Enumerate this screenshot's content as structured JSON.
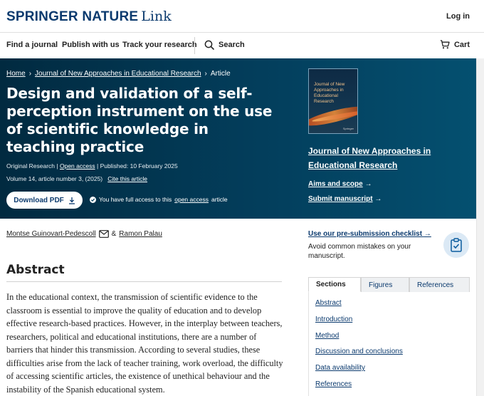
{
  "header": {
    "logo_brand": "SPRINGER NATURE",
    "logo_product": "Link",
    "login": "Log in"
  },
  "nav": {
    "find_journal": "Find a journal",
    "publish": "Publish with us",
    "track": "Track your research",
    "search": "Search",
    "cart": "Cart"
  },
  "hero": {
    "breadcrumb": {
      "home": "Home",
      "journal": "Journal of New Approaches in Educational Research",
      "current": "Article"
    },
    "title": "Design and validation of a self-perception instrument on the use of scientific knowledge in teaching practice",
    "meta": {
      "type": "Original Research",
      "open_access": "Open access",
      "published": "Published: 10 February 2025",
      "volume": "Volume 14, article number 3, (2025)",
      "cite": "Cite this article"
    },
    "download": "Download PDF",
    "access_prefix": "You have full access to this",
    "access_link": "open access",
    "access_suffix": "article"
  },
  "journal_panel": {
    "cover_title": "Journal of New Approaches in Educational Research",
    "cover_publisher": "Springer",
    "journal_link": "Journal of New Approaches in Educational Research",
    "aims": "Aims and scope",
    "submit": "Submit manuscript"
  },
  "authors": {
    "author1": "Montse Guinovart-Pedescoll",
    "amp": "&",
    "author2": "Ramon Palau"
  },
  "abstract": {
    "heading": "Abstract",
    "text": "In the educational context, the transmission of scientific evidence to the classroom is essential to improve the quality of education and to develop effective research-based practices. However, in the interplay between teachers, researchers, political and educational institutions, there are a number of barriers that hinder this transmission. According to several studies, these difficulties arise from the lack of teacher training, work overload, the difficulty of accessing scientific articles, the existence of unethical behaviour and the instability of the Spanish educational system."
  },
  "checklist": {
    "link": "Use our pre-submission checklist",
    "desc": "Avoid common mistakes on your manuscript."
  },
  "tabs": [
    "Sections",
    "Figures",
    "References"
  ],
  "sections": [
    "Abstract",
    "Introduction",
    "Method",
    "Discussion and conclusions",
    "Data availability",
    "References"
  ],
  "colors": {
    "hero_bg": "#033e5c",
    "link_blue": "#0b3a6e"
  }
}
